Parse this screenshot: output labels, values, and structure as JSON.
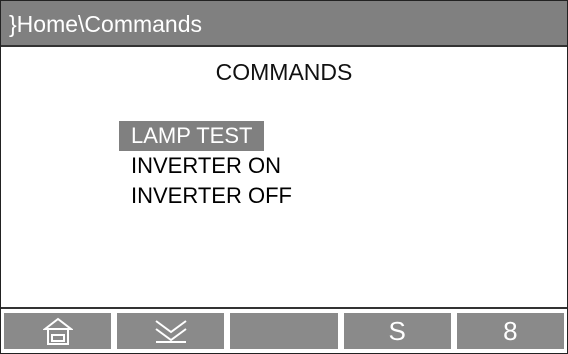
{
  "titlebar": {
    "path": "}Home\\Commands"
  },
  "page": {
    "title": "COMMANDS"
  },
  "menu": {
    "items": [
      {
        "label": "LAMP TEST",
        "selected": true
      },
      {
        "label": "INVERTER ON",
        "selected": false
      },
      {
        "label": "INVERTER OFF",
        "selected": false
      }
    ]
  },
  "footer": {
    "buttons": [
      {
        "icon": "home-icon",
        "label": ""
      },
      {
        "icon": "double-chevron-down-icon",
        "label": ""
      },
      {
        "icon": "",
        "label": ""
      },
      {
        "icon": "",
        "label": "S"
      },
      {
        "icon": "",
        "label": "8"
      }
    ]
  },
  "colors": {
    "titlebar_bg": "#808080",
    "button_bg": "#8a8a8a",
    "highlight_bg": "#808080"
  }
}
